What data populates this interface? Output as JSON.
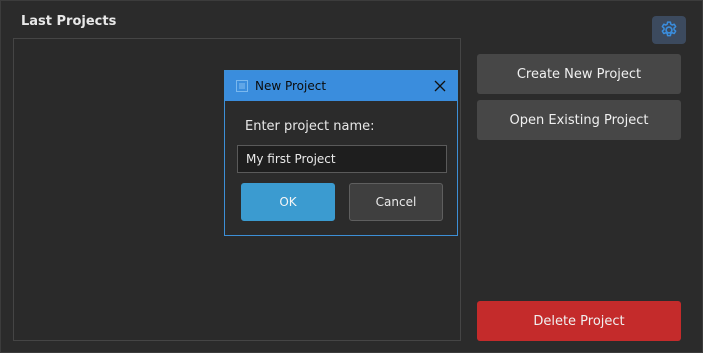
{
  "main": {
    "section_title": "Last Projects"
  },
  "actions": {
    "create_label": "Create New Project",
    "open_label": "Open Existing Project",
    "delete_label": "Delete Project"
  },
  "settings": {
    "icon": "gear-icon",
    "color": "#3a8ddd"
  },
  "dialog": {
    "title": "New Project",
    "prompt": "Enter project name:",
    "input_value": "My first Project",
    "ok_label": "OK",
    "cancel_label": "Cancel",
    "accent": "#3a8ddd"
  },
  "colors": {
    "delete": "#c42b2b",
    "ok": "#3b9bd0"
  }
}
